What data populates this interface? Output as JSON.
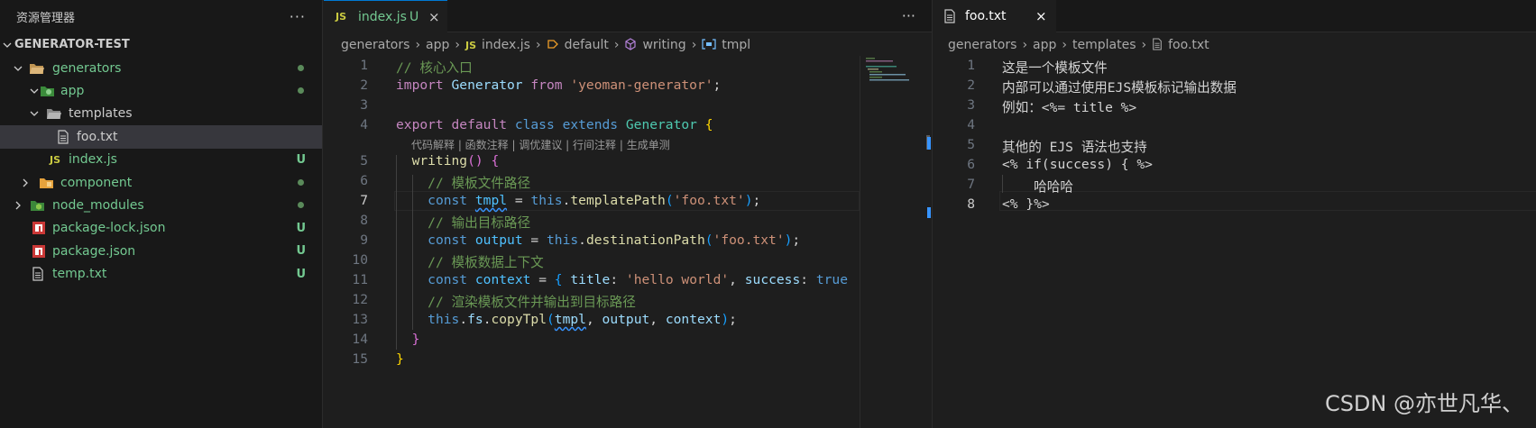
{
  "explorer": {
    "title": "资源管理器",
    "more": "···",
    "root": "GENERATOR-TEST",
    "items": [
      {
        "label": "generators",
        "status": "dot"
      },
      {
        "label": "app",
        "status": "dot"
      },
      {
        "label": "templates",
        "status": ""
      },
      {
        "label": "foo.txt",
        "status": ""
      },
      {
        "label": "index.js",
        "status": "U",
        "icon_text": "JS"
      },
      {
        "label": "component",
        "status": "dot"
      },
      {
        "label": "node_modules",
        "status": "dot"
      },
      {
        "label": "package-lock.json",
        "status": "U"
      },
      {
        "label": "package.json",
        "status": "U"
      },
      {
        "label": "temp.txt",
        "status": "U"
      }
    ]
  },
  "editor1": {
    "tab": {
      "icon_text": "JS",
      "label": "index.js",
      "status": "U",
      "close": "×"
    },
    "more": "···",
    "breadcrumb": [
      "generators",
      "app",
      "index.js",
      "default",
      "writing",
      "tmpl"
    ],
    "breadcrumb_js_icon": "JS",
    "codelens": "代码解释 | 函数注释 | 调优建议 | 行间注释 | 生成单测",
    "line_numbers": [
      "1",
      "2",
      "3",
      "4",
      "5",
      "6",
      "7",
      "8",
      "9",
      "10",
      "11",
      "12",
      "13",
      "14",
      "15"
    ],
    "active_line": "7"
  },
  "editor2": {
    "tab": {
      "label": "foo.txt",
      "close": "×"
    },
    "breadcrumb": [
      "generators",
      "app",
      "templates",
      "foo.txt"
    ],
    "line_numbers": [
      "1",
      "2",
      "3",
      "4",
      "5",
      "6",
      "7",
      "8"
    ],
    "lines": [
      "这是一个模板文件",
      "内部可以通过使用EJS模板标记输出数据",
      "例如：<%= title %>",
      "",
      "其他的 EJS 语法也支持",
      "<% if(success) { %>",
      "    哈哈哈",
      "<% }%>"
    ],
    "active_line": "8"
  },
  "watermark": "CSDN @亦世凡华、",
  "colors": {
    "bg": "#1e1e1e",
    "sidebar_bg": "#181818",
    "git_untracked": "#73c991",
    "js_yellow": "#cbcb41",
    "npm_red": "#cb3837",
    "folder": "#c09553"
  }
}
